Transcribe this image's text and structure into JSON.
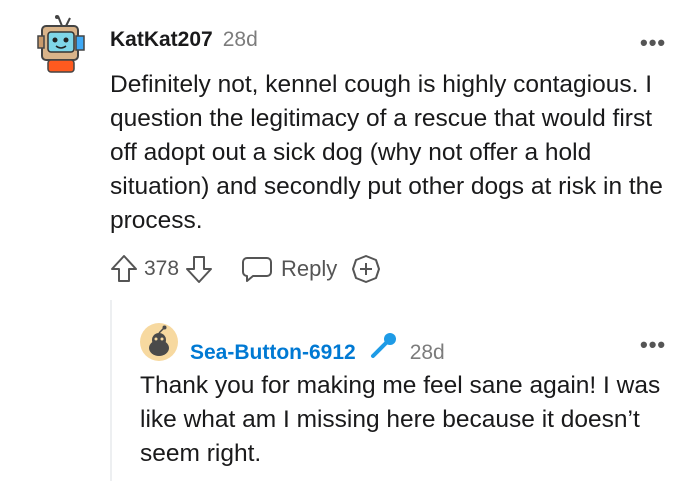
{
  "comment": {
    "username": "KatKat207",
    "time": "28d",
    "text": "Definitely not, kennel cough is highly contagious. I question the legitimacy of a rescue that would first off adopt out a sick dog (why not offer a hold situation) and secondly put other dogs at risk in the process.",
    "votes": "378",
    "reply_label": "Reply"
  },
  "reply": {
    "username": "Sea-Button-6912",
    "time": "28d",
    "text": "Thank you for making me feel sane again! I was like what am I missing here because it doesn’t seem right."
  },
  "more_label": "•••",
  "colors": {
    "text": "#1a1a1b",
    "muted": "#7c7c7c",
    "op_blue": "#0079d3",
    "avatar_bg": "#f7d9a0"
  }
}
